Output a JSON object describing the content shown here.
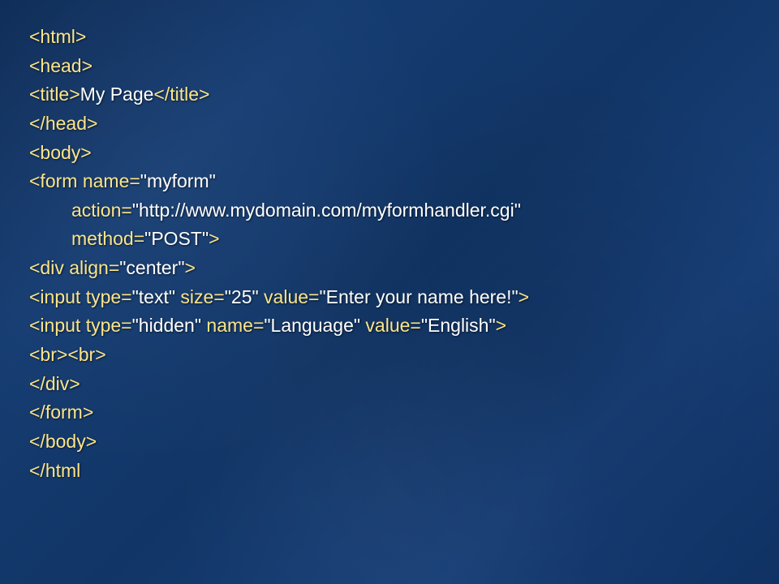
{
  "lines": {
    "l1": {
      "a": "<html>"
    },
    "l2": {
      "a": "<head>"
    },
    "l3": {
      "a": "<title>",
      "b": "My Page",
      "c": "</title>"
    },
    "l4": {
      "a": "</head>"
    },
    "l5": {
      "a": "<body>"
    },
    "l6a": {
      "a": "<form name=",
      "b": "\"myform\""
    },
    "l6b": {
      "a": "action=",
      "b": "\"http://www.mydomain.com/myformhandler.cgi\""
    },
    "l6c": {
      "a": "method=",
      "b": "\"POST\"",
      "c": ">"
    },
    "l7": {
      "a": "<div align=",
      "b": "\"center\"",
      "c": ">"
    },
    "l8": {
      "a": "<input type=",
      "b": "\"text\"",
      "c": " size=",
      "d": "\"25\"",
      "e": " value=",
      "f": "\"Enter your name here!\"",
      "g": ">"
    },
    "l9": {
      "a": "<input type=",
      "b": "\"hidden\"",
      "c": " name=",
      "d": "\"Language\"",
      "e": " value=",
      "f": "\"English\"",
      "g": ">"
    },
    "l10": {
      "a": "<br><br>"
    },
    "l11": {
      "a": "</div>"
    },
    "l12": {
      "a": "</form>"
    },
    "l13": {
      "a": "</body>"
    },
    "l14": {
      "a": "</html"
    }
  }
}
